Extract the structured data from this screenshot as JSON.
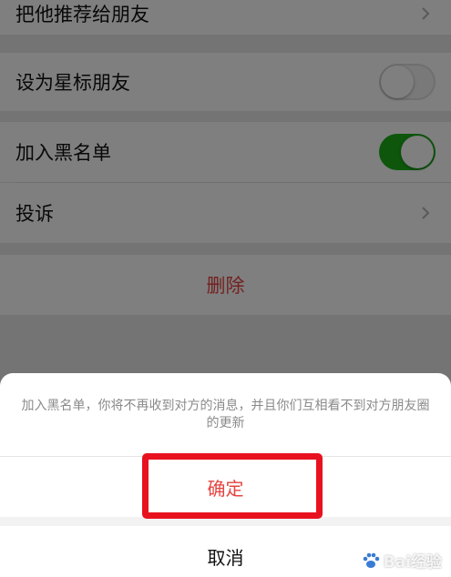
{
  "settings": {
    "recommend_label": "把他推荐给朋友",
    "star_label": "设为星标朋友",
    "star_on": false,
    "blacklist_label": "加入黑名单",
    "blacklist_on": true,
    "complaint_label": "投诉",
    "delete_label": "删除"
  },
  "sheet": {
    "message": "加入黑名单，你将不再收到对方的消息，并且你们互相看不到对方朋友圈的更新",
    "confirm_label": "确定",
    "cancel_label": "取消"
  },
  "watermark": {
    "text": "Bai经验"
  },
  "colors": {
    "toggle_on": "#1aad19",
    "danger": "#e64340",
    "highlight": "#e8121f"
  }
}
